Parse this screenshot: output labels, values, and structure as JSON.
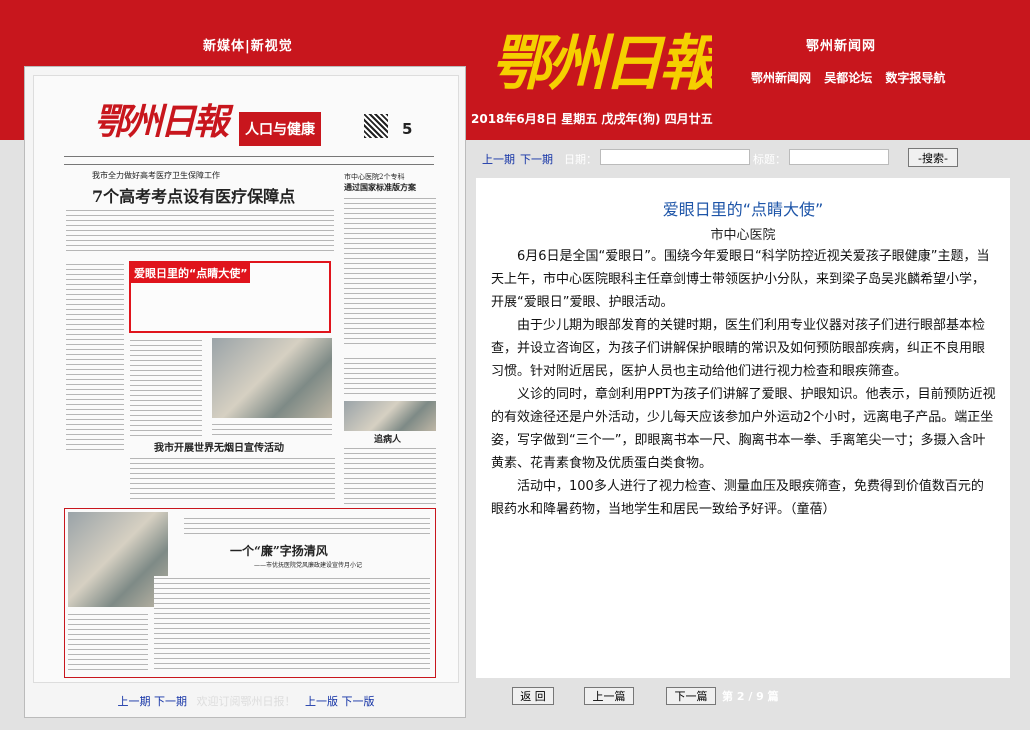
{
  "header": {
    "left_title": "新媒体|新视觉",
    "right_title": "鄂州新闻网",
    "links": [
      "鄂州新闻网",
      "吴都论坛",
      "数字报导航"
    ],
    "date": "2018年6月8日 星期五 戊戌年(狗) 四月廿五",
    "logo_text": "鄂州日報",
    "colors": {
      "brand_red": "#c8161d",
      "link_blue": "#1433a6",
      "title_blue": "#1e55a8"
    }
  },
  "newspaper": {
    "section_name": "人口与健康",
    "page_number": "5",
    "headline_main": "7个高考考点设有医疗保障点",
    "headline_sub": "我市全力做好高考医疗卫生保障工作",
    "right_headline_top": "市中心医院2个专科",
    "right_headline_sub": "通过国家标准版方案",
    "middle_headline": "我市开展世界无烟日宣传活动",
    "bottom_headline": "一个“廉”字扬清风",
    "bottom_subhead": "——市优抚医院党风廉政建设宣传月小记",
    "right_small": "追病人",
    "highlight_label": "爱眼日里的“点睛大使”",
    "nav": {
      "prev_issue": "上一期",
      "next_issue": "下一期",
      "welcome": "欢迎订阅鄂州日报！",
      "prev_page": "上一版",
      "next_page": "下一版"
    }
  },
  "search": {
    "prev_issue": "上一期",
    "next_issue": "下一期",
    "date_label": "日期：",
    "title_label": "标题：",
    "date_value": "",
    "title_value": "",
    "button": "-搜索-"
  },
  "article": {
    "title": "爱眼日里的“点睛大使”",
    "author": "市中心医院",
    "paragraphs": [
      "6月6日是全国“爱眼日”。围绕今年爱眼日“科学防控近视关爱孩子眼健康”主题，当天上午，市中心医院眼科主任章剑博士带领医护小分队，来到梁子岛吴兆麟希望小学，开展“爱眼日”爱眼、护眼活动。",
      "由于少儿期为眼部发育的关键时期，医生们利用专业仪器对孩子们进行眼部基本检查，并设立咨询区，为孩子们讲解保护眼睛的常识及如何预防眼部疾病，纠正不良用眼习惯。针对附近居民，医护人员也主动给他们进行视力检查和眼疾筛查。",
      "义诊的同时，章剑利用PPT为孩子们讲解了爱眼、护眼知识。他表示，目前预防近视的有效途径还是户外活动，少儿每天应该参加户外运动2个小时，远离电子产品。端正坐姿，写字做到“三个一”，即眼离书本一尺、胸离书本一拳、手离笔尖一寸；多摄入含叶黄素、花青素食物及优质蛋白类食物。",
      "活动中，100多人进行了视力检查、测量血压及眼疾筛查，免费得到价值数百元的眼药水和降暑药物，当地学生和居民一致给予好评。（童蓓）"
    ]
  },
  "bottom_nav": {
    "back": "返 回",
    "prev_article": "上一篇",
    "next_article": "下一篇",
    "page_info": "第 2 / 9 篇"
  }
}
